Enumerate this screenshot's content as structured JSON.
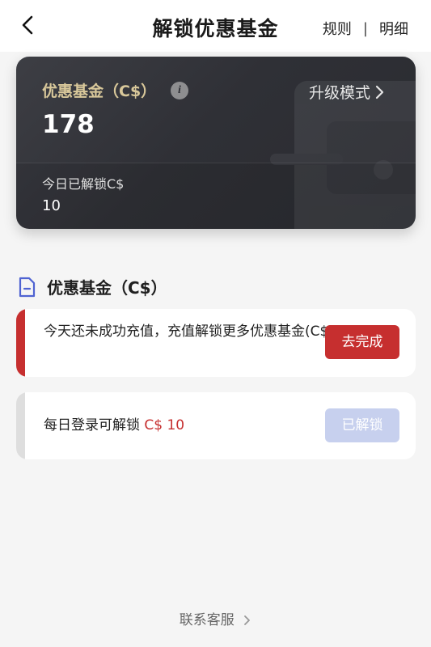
{
  "header": {
    "title": "解锁优惠基金",
    "rules_label": "规则",
    "separator": "|",
    "detail_label": "明细"
  },
  "card": {
    "label": "优惠基金（C$）",
    "info_icon_glyph": "i",
    "amount": "178",
    "upgrade_label": "升级模式",
    "today_label": "今日已解锁C$",
    "today_value": "10"
  },
  "section": {
    "title": "优惠基金（C$）"
  },
  "tasks": [
    {
      "text": "今天还未成功充值，充值解锁更多优惠基金(C$)",
      "button_label": "去完成",
      "status": "pending"
    },
    {
      "text_prefix": "每日登录可解锁",
      "amount": "C$ 10",
      "button_label": "已解锁",
      "status": "unlocked"
    }
  ],
  "footer": {
    "contact_label": "联系客服"
  },
  "colors": {
    "accent_red": "#c62f2f",
    "gold": "#d9c89a",
    "disabled_button": "#c7d0ee",
    "disabled_bar": "#dedede"
  }
}
